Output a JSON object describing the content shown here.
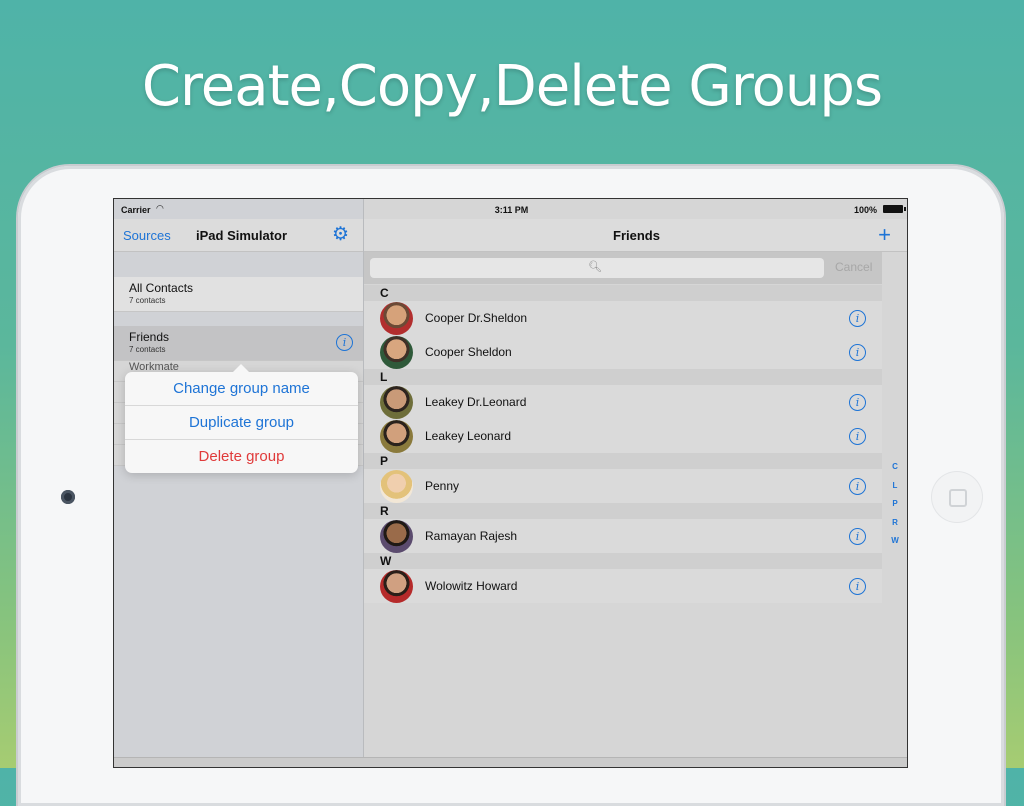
{
  "headline": "Create,Copy,Delete Groups",
  "status_bar": {
    "carrier": "Carrier",
    "time": "3:11 PM",
    "battery": "100%"
  },
  "master": {
    "nav": {
      "sources_label": "Sources",
      "title": "iPad Simulator"
    },
    "groups": [
      {
        "name": "All Contacts",
        "count": "7 contacts"
      },
      {
        "name": "Friends",
        "count": "7 contacts"
      }
    ],
    "partially_hidden": [
      "Workmate"
    ]
  },
  "popover": {
    "change_name": "Change group name",
    "duplicate": "Duplicate group",
    "delete": "Delete group"
  },
  "detail": {
    "nav": {
      "title": "Friends"
    },
    "search": {
      "cancel_label": "Cancel"
    },
    "sections": [
      {
        "letter": "C",
        "contacts": [
          "Cooper Dr.Sheldon",
          "Cooper Sheldon"
        ]
      },
      {
        "letter": "L",
        "contacts": [
          "Leakey Dr.Leonard",
          "Leakey Leonard"
        ]
      },
      {
        "letter": "P",
        "contacts": [
          "Penny"
        ]
      },
      {
        "letter": "R",
        "contacts": [
          "Ramayan Rajesh"
        ]
      },
      {
        "letter": "W",
        "contacts": [
          "Wolowitz Howard"
        ]
      }
    ],
    "index": [
      "C",
      "L",
      "P",
      "R",
      "W"
    ]
  },
  "colors": {
    "accent": "#1e74d6",
    "danger": "#e03a3a",
    "bg_top": "#4fb3a8",
    "bg_bottom": "#a6cc72"
  },
  "icons": {
    "gear": "gear-icon",
    "plus": "plus-icon",
    "info": "info-icon",
    "search": "search-icon",
    "wifi": "wifi-icon"
  }
}
